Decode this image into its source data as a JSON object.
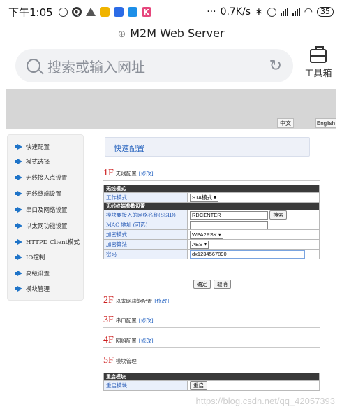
{
  "status_bar": {
    "time": "下午1:05",
    "speed": "0.7K/s",
    "dots": "···",
    "battery": "35",
    "bluetooth": "∗"
  },
  "browser": {
    "page_title": "M2M Web Server",
    "address_placeholder": "搜索或输入网址",
    "toolbox_label": "工具箱"
  },
  "header": {
    "lang_cn": "中文",
    "lang_en": "English"
  },
  "menu": {
    "items": [
      {
        "label": "快速配置"
      },
      {
        "label": "模式选择"
      },
      {
        "label": "无线接入点设置"
      },
      {
        "label": "无线终端设置"
      },
      {
        "label": "串口及网络设置"
      },
      {
        "label": "以太网功能设置"
      },
      {
        "label": "HTTPD Client模式"
      },
      {
        "label": "IO控制"
      },
      {
        "label": "高级设置"
      },
      {
        "label": "模块管理"
      }
    ]
  },
  "content": {
    "heading": "快速配置",
    "sections": [
      {
        "num": "1F",
        "title": "无线配置",
        "edit": "[修改]"
      },
      {
        "num": "2F",
        "title": "以太网功能配置",
        "edit": "[修改]"
      },
      {
        "num": "3F",
        "title": "串口配置",
        "edit": "[修改]"
      },
      {
        "num": "4F",
        "title": "网络配置",
        "edit": "[修改]"
      },
      {
        "num": "5F",
        "title": "模块管理",
        "edit": ""
      }
    ],
    "wifi_table": {
      "hdr_wireless": "无线模式",
      "work_mode_label": "工作模式",
      "work_mode_value": "STA模式",
      "hdr_terminal": "无线终端参数设置",
      "ssid_label": "模块要接入的网络名称(SSID)",
      "ssid_value": "RDCENTER",
      "search_btn": "搜索",
      "mac_label": "MAC 地址 (可选)",
      "mac_value": "",
      "enc_mode_label": "加密模式",
      "enc_mode_value": "WPA2PSK",
      "enc_alg_label": "加密算法",
      "enc_alg_value": "AES",
      "pwd_label": "密码",
      "pwd_value": "dx1234567890"
    },
    "ok_btn": "确定",
    "cancel_btn": "取消",
    "restart_table": {
      "hdr": "重启模块",
      "label": "重启模块",
      "btn": "重启"
    }
  },
  "watermark": "https://blog.csdn.net/qq_42057393"
}
